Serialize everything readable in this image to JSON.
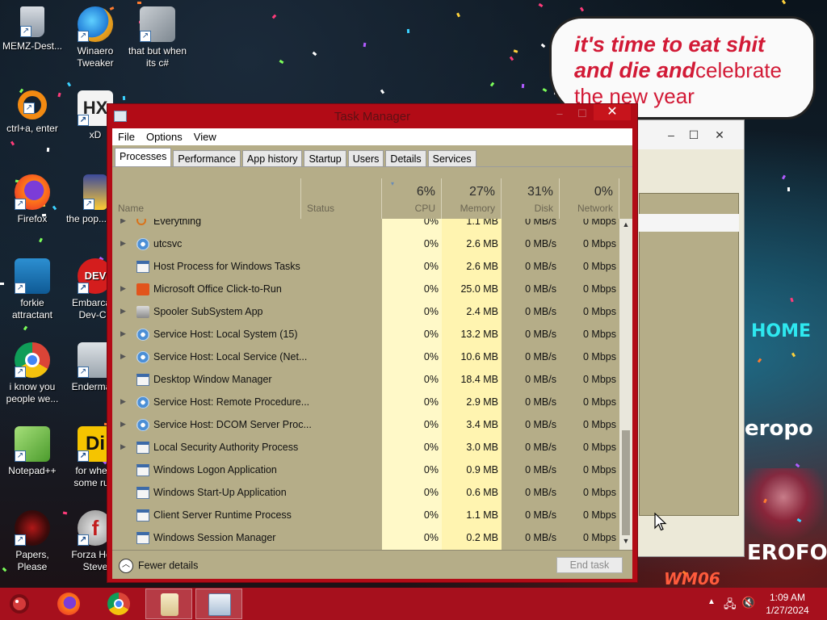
{
  "bubble": {
    "line1": "it's time to eat shit",
    "line2a": "and die and",
    "line2b": "celebrate",
    "line3": "the new year"
  },
  "desktop_icons": [
    {
      "label": "MEMZ-Dest...",
      "icon": "recycle-bin-icon"
    },
    {
      "label": "Winaero Tweaker",
      "icon": "winaero-icon"
    },
    {
      "label": "that but when its c#",
      "icon": "stacked-windows-icon"
    },
    {
      "label": "ctrl+a, enter",
      "icon": "orange-ring-icon"
    },
    {
      "label": "xD",
      "icon": "hex-editor-icon"
    },
    {
      "label": "Firefox",
      "icon": "firefox-icon"
    },
    {
      "label": "the pop... shit",
      "icon": "bottle-icon"
    },
    {
      "label": "forkie attractant",
      "icon": "gear-monitor-icon"
    },
    {
      "label": "Embarca... Dev-C+",
      "icon": "devcpp-icon"
    },
    {
      "label": "i know you people we...",
      "icon": "chrome-icon"
    },
    {
      "label": "Enderma...",
      "icon": "monitor-icon"
    },
    {
      "label": "Notepad++",
      "icon": "notepadpp-icon"
    },
    {
      "label": "for whe... some ru...",
      "icon": "di-icon"
    },
    {
      "label": "Papers, Please",
      "icon": "papers-please-icon"
    },
    {
      "label": "Forza Ho... Steve",
      "icon": "flash-icon"
    }
  ],
  "wallpaper_signs": {
    "home": "HOME",
    "cropo": "eropo",
    "aerofos": "EROFOS",
    "wm": "WM06"
  },
  "taskmanager": {
    "title": "Task Manager",
    "menu": [
      "File",
      "Options",
      "View"
    ],
    "tabs": [
      "Processes",
      "Performance",
      "App history",
      "Startup",
      "Users",
      "Details",
      "Services"
    ],
    "active_tab": "Processes",
    "columns": {
      "name": "Name",
      "status": "Status",
      "cpu": {
        "pct": "6%",
        "label": "CPU"
      },
      "memory": {
        "pct": "27%",
        "label": "Memory"
      },
      "disk": {
        "pct": "31%",
        "label": "Disk"
      },
      "network": {
        "pct": "0%",
        "label": "Network"
      }
    },
    "processes": [
      {
        "name": "Everything",
        "cpu": "0%",
        "memory": "1.1 MB",
        "disk": "0 MB/s",
        "network": "0 Mbps",
        "expandable": true,
        "icon": "search-icon"
      },
      {
        "name": "utcsvc",
        "cpu": "0%",
        "memory": "2.6 MB",
        "disk": "0 MB/s",
        "network": "0 Mbps",
        "expandable": true,
        "icon": "gear-icon"
      },
      {
        "name": "Host Process for Windows Tasks",
        "cpu": "0%",
        "memory": "2.6 MB",
        "disk": "0 MB/s",
        "network": "0 Mbps",
        "expandable": false,
        "icon": "window-icon"
      },
      {
        "name": "Microsoft Office Click-to-Run",
        "cpu": "0%",
        "memory": "25.0 MB",
        "disk": "0 MB/s",
        "network": "0 Mbps",
        "expandable": true,
        "icon": "office-icon"
      },
      {
        "name": "Spooler SubSystem App",
        "cpu": "0%",
        "memory": "2.4 MB",
        "disk": "0 MB/s",
        "network": "0 Mbps",
        "expandable": true,
        "icon": "printer-icon"
      },
      {
        "name": "Service Host: Local System (15)",
        "cpu": "0%",
        "memory": "13.2 MB",
        "disk": "0 MB/s",
        "network": "0 Mbps",
        "expandable": true,
        "icon": "gear-icon"
      },
      {
        "name": "Service Host: Local Service (Net...",
        "cpu": "0%",
        "memory": "10.6 MB",
        "disk": "0 MB/s",
        "network": "0 Mbps",
        "expandable": true,
        "icon": "gear-icon"
      },
      {
        "name": "Desktop Window Manager",
        "cpu": "0%",
        "memory": "18.4 MB",
        "disk": "0 MB/s",
        "network": "0 Mbps",
        "expandable": false,
        "icon": "window-icon"
      },
      {
        "name": "Service Host: Remote Procedure...",
        "cpu": "0%",
        "memory": "2.9 MB",
        "disk": "0 MB/s",
        "network": "0 Mbps",
        "expandable": true,
        "icon": "gear-icon"
      },
      {
        "name": "Service Host: DCOM Server Proc...",
        "cpu": "0%",
        "memory": "3.4 MB",
        "disk": "0 MB/s",
        "network": "0 Mbps",
        "expandable": true,
        "icon": "gear-icon"
      },
      {
        "name": "Local Security Authority Process",
        "cpu": "0%",
        "memory": "3.0 MB",
        "disk": "0 MB/s",
        "network": "0 Mbps",
        "expandable": true,
        "icon": "window-icon"
      },
      {
        "name": "Windows Logon Application",
        "cpu": "0%",
        "memory": "0.9 MB",
        "disk": "0 MB/s",
        "network": "0 Mbps",
        "expandable": false,
        "icon": "window-icon"
      },
      {
        "name": "Windows Start-Up Application",
        "cpu": "0%",
        "memory": "0.6 MB",
        "disk": "0 MB/s",
        "network": "0 Mbps",
        "expandable": false,
        "icon": "window-icon"
      },
      {
        "name": "Client Server Runtime Process",
        "cpu": "0%",
        "memory": "1.1 MB",
        "disk": "0 MB/s",
        "network": "0 Mbps",
        "expandable": false,
        "icon": "window-icon"
      },
      {
        "name": "Windows Session Manager",
        "cpu": "0%",
        "memory": "0.2 MB",
        "disk": "0 MB/s",
        "network": "0 Mbps",
        "expandable": false,
        "icon": "window-icon"
      }
    ],
    "footer": {
      "fewer_details": "Fewer details",
      "end_task": "End task"
    },
    "colors": {
      "window_frame": "#b20b16",
      "body": "#b5ad88",
      "cpu_col": "#fff9c8",
      "mem_col": "#fff4b0"
    }
  },
  "taskbar": {
    "pinned": [
      "firefox-icon",
      "chrome-icon",
      "notepad-scroll-icon",
      "taskmanager-icon"
    ],
    "time": "1:09 AM",
    "date": "1/27/2024",
    "tray_icons": [
      "chevron-up-icon",
      "network-icon",
      "volume-muted-icon"
    ],
    "color": "#a6101d"
  }
}
